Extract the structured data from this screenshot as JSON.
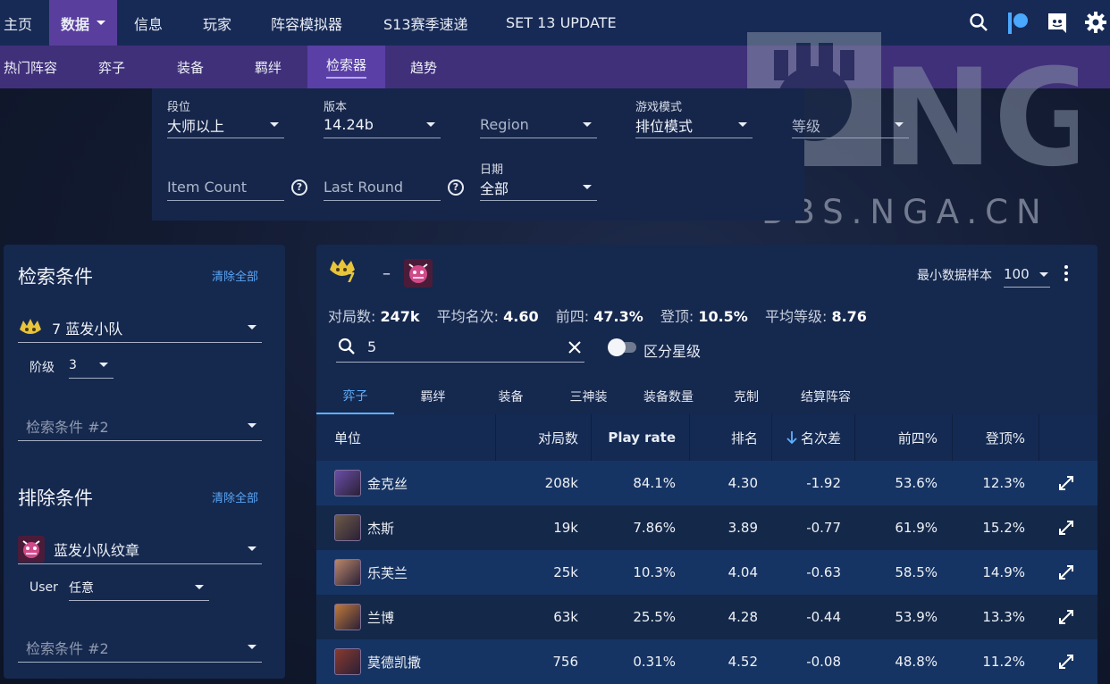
{
  "topnav": {
    "items": [
      {
        "label": "主页",
        "active": false
      },
      {
        "label": "数据",
        "active": true
      },
      {
        "label": "信息",
        "active": false
      },
      {
        "label": "玩家",
        "active": false
      },
      {
        "label": "阵容模拟器",
        "active": false
      },
      {
        "label": "S13赛季速递",
        "active": false
      },
      {
        "label": "SET 13 UPDATE",
        "active": false
      }
    ],
    "icons": [
      "search-icon",
      "patreon-icon",
      "discord-icon",
      "gear-icon"
    ]
  },
  "subnav": {
    "items": [
      {
        "label": "热门阵容",
        "active": false
      },
      {
        "label": "弈子",
        "active": false
      },
      {
        "label": "装备",
        "active": false
      },
      {
        "label": "羁绊",
        "active": false
      },
      {
        "label": "检索器",
        "active": true
      },
      {
        "label": "趋势",
        "active": false
      }
    ]
  },
  "filters": {
    "rank": {
      "label": "段位",
      "value": "大师以上"
    },
    "version": {
      "label": "版本",
      "value": "14.24b"
    },
    "region": {
      "placeholder": "Region"
    },
    "game_mode": {
      "label": "游戏模式",
      "value": "排位模式"
    },
    "level": {
      "placeholder": "等级"
    },
    "item_count": {
      "placeholder": "Item Count"
    },
    "last_round": {
      "placeholder": "Last Round"
    },
    "date": {
      "label": "日期",
      "value": "全部"
    }
  },
  "watermark": {
    "text": "NGA",
    "url": "BBS.NGA.CN"
  },
  "left_panel": {
    "search_title": "检索条件",
    "clear_all_1": "清除全部",
    "search_condition_1": "7 蓝发小队",
    "tier_label": "阶级",
    "tier_value": "3",
    "search_placeholder_2": "检索条件 #2",
    "exclude_title": "排除条件",
    "clear_all_2": "清除全部",
    "exclude_condition_1": "蓝发小队纹章",
    "user_label": "User",
    "user_value": "任意",
    "exclude_placeholder_2": "检索条件 #2"
  },
  "main": {
    "trait_count": "7",
    "separator": "–",
    "min_sample_label": "最小数据样本",
    "min_sample_value": "100",
    "stats": {
      "games_label": "对局数:",
      "games_value": "247k",
      "avg_place_label": "平均名次:",
      "avg_place_value": "4.60",
      "top4_label": "前四:",
      "top4_value": "47.3%",
      "win_label": "登顶:",
      "win_value": "10.5%",
      "avg_level_label": "平均等级:",
      "avg_level_value": "8.76"
    },
    "search_value": "5",
    "star_toggle_label": "区分星级",
    "tabs": [
      {
        "label": "弈子",
        "active": true
      },
      {
        "label": "羁绊",
        "active": false
      },
      {
        "label": "装备",
        "active": false
      },
      {
        "label": "三神装",
        "active": false
      },
      {
        "label": "装备数量",
        "active": false
      },
      {
        "label": "克制",
        "active": false
      },
      {
        "label": "结算阵容",
        "active": false
      }
    ],
    "table": {
      "columns": [
        "单位",
        "对局数",
        "Play rate",
        "排名",
        "名次差",
        "前四%",
        "登顶%"
      ],
      "rows": [
        {
          "unit": "金克丝",
          "games": "208k",
          "play_rate": "84.1%",
          "rank": "4.30",
          "delta": "-1.92",
          "top4": "53.6%",
          "win": "12.3%",
          "color": "#6a4ea8"
        },
        {
          "unit": "杰斯",
          "games": "19k",
          "play_rate": "7.86%",
          "rank": "3.89",
          "delta": "-0.77",
          "top4": "61.9%",
          "win": "15.2%",
          "color": "#6d5a48"
        },
        {
          "unit": "乐芙兰",
          "games": "25k",
          "play_rate": "10.3%",
          "rank": "4.04",
          "delta": "-0.63",
          "top4": "58.5%",
          "win": "14.9%",
          "color": "#b9876a"
        },
        {
          "unit": "兰博",
          "games": "63k",
          "play_rate": "25.5%",
          "rank": "4.28",
          "delta": "-0.44",
          "top4": "53.9%",
          "win": "13.3%",
          "color": "#c07a3a"
        },
        {
          "unit": "莫德凯撒",
          "games": "756",
          "play_rate": "0.31%",
          "rank": "4.52",
          "delta": "-0.08",
          "top4": "48.8%",
          "win": "11.2%",
          "color": "#8a3a2e"
        }
      ]
    }
  }
}
